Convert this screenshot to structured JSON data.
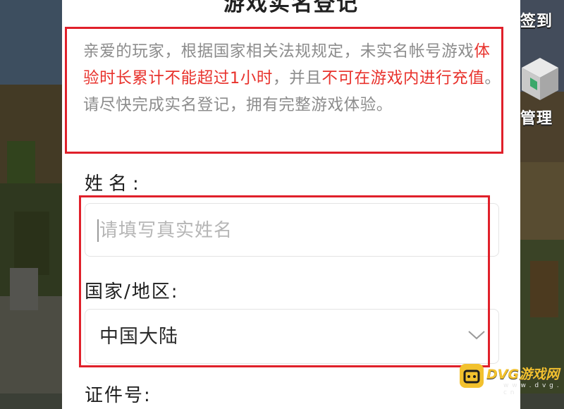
{
  "modal": {
    "title": "游戏实名登记",
    "notice": {
      "part1": "亲爱的玩家，根据国家相关法规规定，未实名帐号游戏",
      "highlight1": "体验时长累计不能超过1小时",
      "part2": "，并且",
      "highlight2": "不可在游戏内进行充值",
      "part3": "。请尽快完成实名登记，拥有完整游戏体验。"
    },
    "name_label": "姓名:",
    "name_placeholder": "请填写真实姓名",
    "region_label": "国家/地区:",
    "region_value": "中国大陆",
    "id_label": "证件号:"
  },
  "game_ui": {
    "sign_in_label": "签到",
    "manage_label": "管理"
  },
  "watermark": {
    "brand": "DVG游戏网",
    "domain": "w w w . d v g . c n"
  },
  "colors": {
    "highlight_red": "#e8322c",
    "annotation_box": "#e0202a",
    "watermark_yellow": "#f2c12e"
  }
}
